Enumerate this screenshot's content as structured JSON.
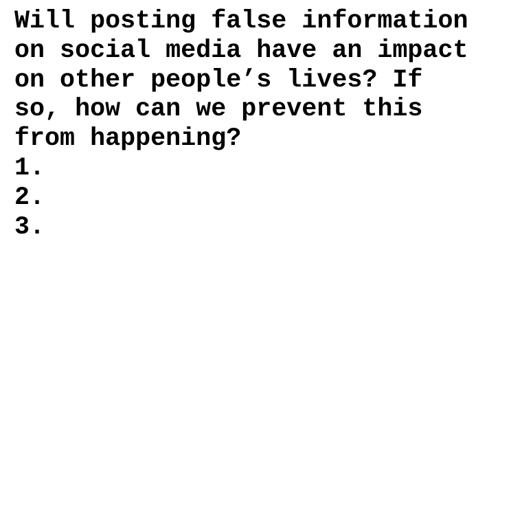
{
  "question": {
    "lines": [
      "Will posting false information",
      "on social media have an impact",
      "on other people’s lives? If",
      "so, how can we prevent this",
      "from happening?"
    ]
  },
  "list": {
    "items": [
      "1.",
      "2.",
      "3."
    ]
  }
}
